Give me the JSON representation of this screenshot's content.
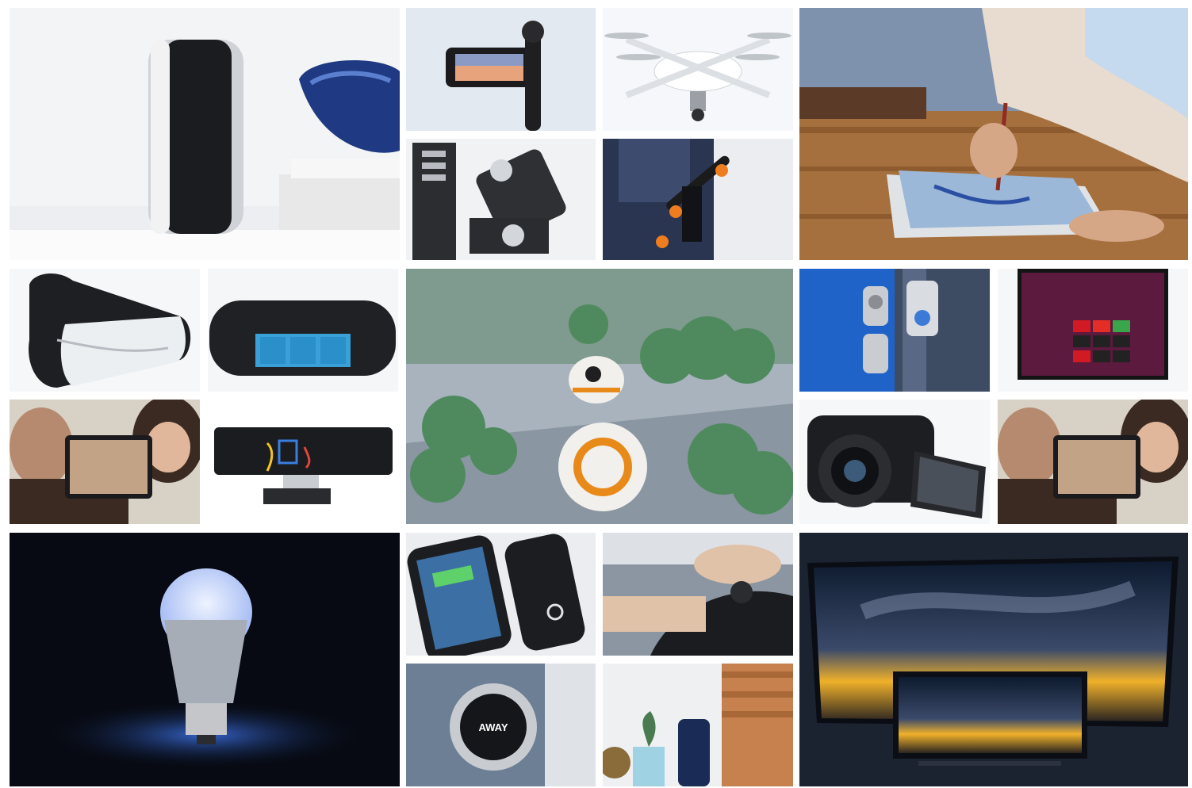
{
  "collage": {
    "tiles": [
      {
        "name": "security-camera-photo"
      },
      {
        "name": "gimbal-camera-photo"
      },
      {
        "name": "drone-photo"
      },
      {
        "name": "drawing-tablet-photo"
      },
      {
        "name": "usb-charger-photo"
      },
      {
        "name": "electric-skateboard-photo"
      },
      {
        "name": "vr-headset-photo"
      },
      {
        "name": "fitness-band-photo"
      },
      {
        "name": "bb8-droid-photo"
      },
      {
        "name": "video-doorbell-photo"
      },
      {
        "name": "smart-tv-photo"
      },
      {
        "name": "video-chat-photo"
      },
      {
        "name": "kinect-sensor-photo"
      },
      {
        "name": "dslr-camera-photo"
      },
      {
        "name": "video-chat-repeat-photo"
      },
      {
        "name": "smart-bulb-photo"
      },
      {
        "name": "power-bank-photo"
      },
      {
        "name": "car-steering-photo"
      },
      {
        "name": "curved-tv-photo"
      },
      {
        "name": "thermostat-photo"
      },
      {
        "name": "wifi-router-photo"
      }
    ]
  },
  "texts": {
    "band_screen": "",
    "thermostat_label": "AWAY"
  },
  "colors": {
    "background": "#ffffff",
    "sky_night": "#0d1a2e",
    "bb8_orange": "#e88a1a",
    "doorbell_blue": "#1f63c9",
    "bulb_glow": "#3b6fe0"
  }
}
